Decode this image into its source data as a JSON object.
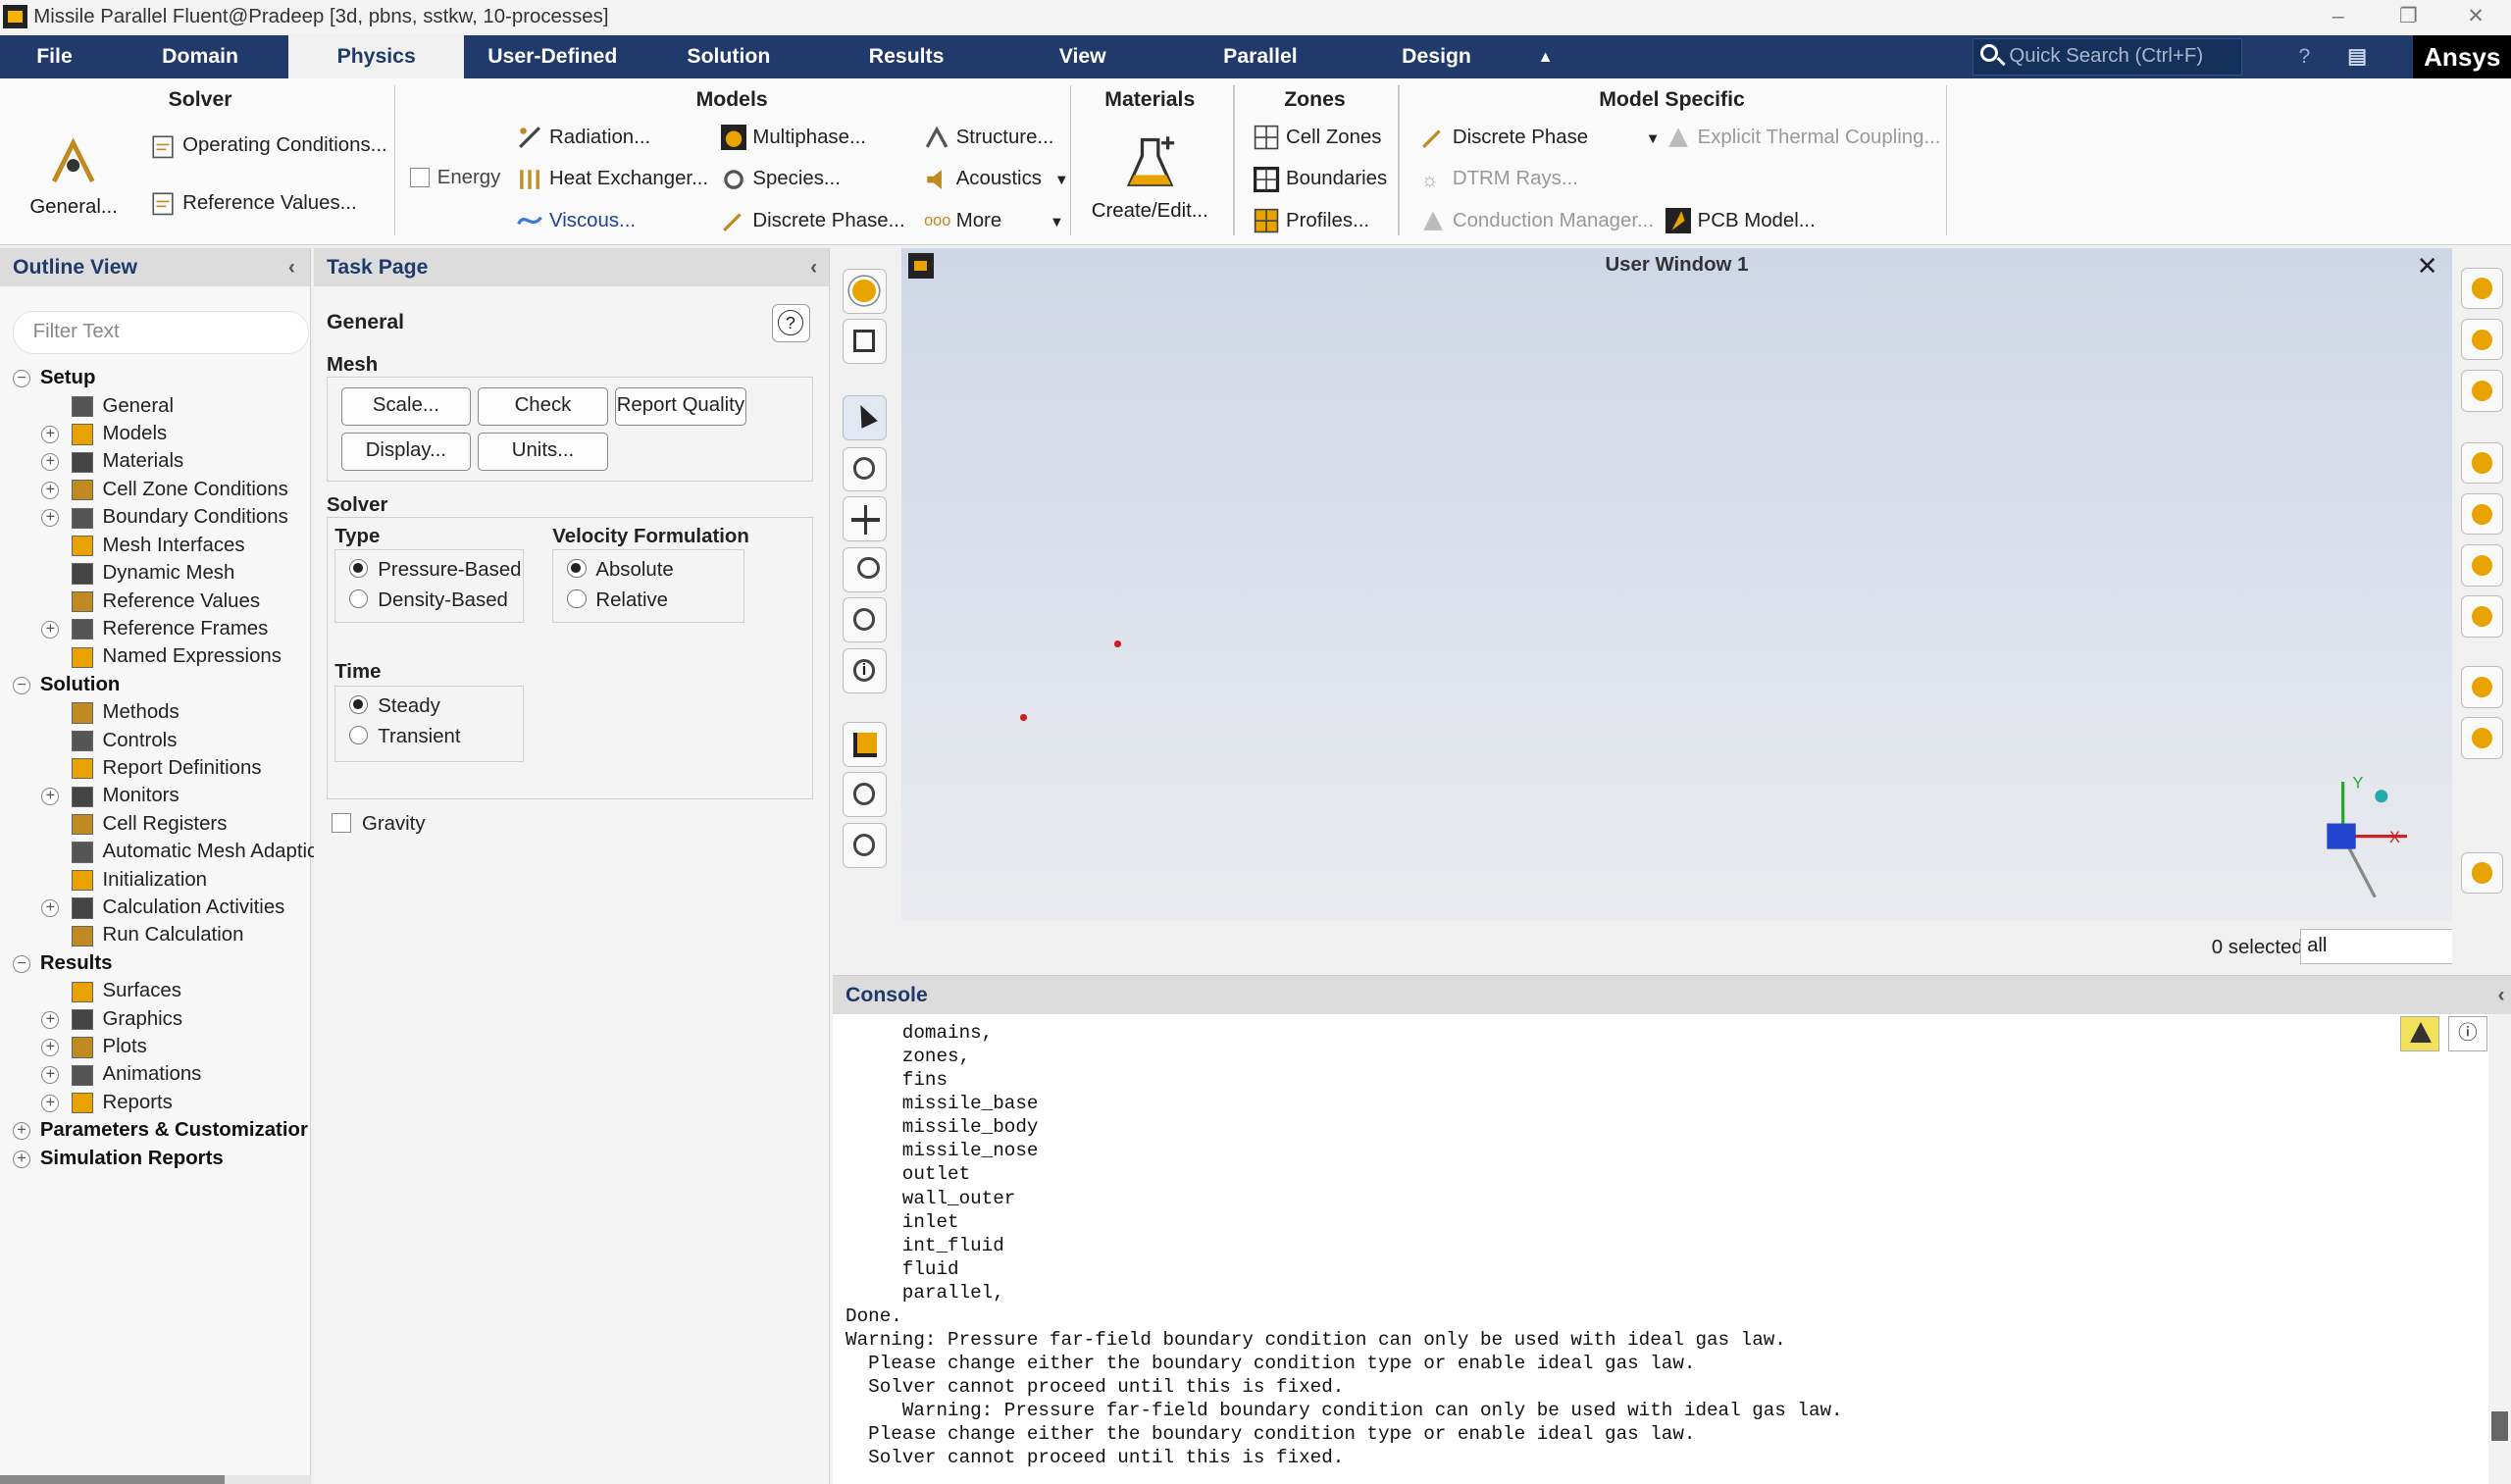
{
  "window": {
    "title": "Missile Parallel Fluent@Pradeep  [3d, pbns, sstkw, 10-processes]"
  },
  "menu": {
    "tabs": [
      "File",
      "Domain",
      "Physics",
      "User-Defined",
      "Solution",
      "Results",
      "View",
      "Parallel",
      "Design"
    ],
    "active": "Physics",
    "search_placeholder": "Quick Search (Ctrl+F)",
    "brand": "Ansys"
  },
  "ribbon": {
    "solver": {
      "title": "Solver",
      "general": "General...",
      "operating": "Operating Conditions...",
      "reference": "Reference Values..."
    },
    "models": {
      "title": "Models",
      "energy": "Energy",
      "radiation": "Radiation...",
      "heat_exchanger": "Heat Exchanger...",
      "viscous": "Viscous...",
      "multiphase": "Multiphase...",
      "species": "Species...",
      "discrete_phase": "Discrete Phase...",
      "structure": "Structure...",
      "acoustics": "Acoustics",
      "more": "More"
    },
    "materials": {
      "title": "Materials",
      "create_edit": "Create/Edit..."
    },
    "zones": {
      "title": "Zones",
      "cell_zones": "Cell Zones",
      "boundaries": "Boundaries",
      "profiles": "Profiles..."
    },
    "model_specific": {
      "title": "Model Specific",
      "discrete_phase": "Discrete Phase",
      "dtrm": "DTRM Rays...",
      "conduction": "Conduction Manager...",
      "explicit_thermal": "Explicit Thermal Coupling...",
      "pcb": "PCB Model..."
    }
  },
  "outline": {
    "title": "Outline View",
    "filter_placeholder": "Filter Text",
    "items": [
      {
        "label": "Setup",
        "level": 0,
        "bold": true,
        "pm": "−"
      },
      {
        "label": "General",
        "level": 1
      },
      {
        "label": "Models",
        "level": 1,
        "pm": "+"
      },
      {
        "label": "Materials",
        "level": 1,
        "pm": "+"
      },
      {
        "label": "Cell Zone Conditions",
        "level": 1,
        "pm": "+"
      },
      {
        "label": "Boundary Conditions",
        "level": 1,
        "pm": "+"
      },
      {
        "label": "Mesh Interfaces",
        "level": 1
      },
      {
        "label": "Dynamic Mesh",
        "level": 1
      },
      {
        "label": "Reference Values",
        "level": 1
      },
      {
        "label": "Reference Frames",
        "level": 1,
        "pm": "+"
      },
      {
        "label": "Named Expressions",
        "level": 1
      },
      {
        "label": "Solution",
        "level": 0,
        "bold": true,
        "pm": "−"
      },
      {
        "label": "Methods",
        "level": 1
      },
      {
        "label": "Controls",
        "level": 1
      },
      {
        "label": "Report Definitions",
        "level": 1
      },
      {
        "label": "Monitors",
        "level": 1,
        "pm": "+"
      },
      {
        "label": "Cell Registers",
        "level": 1
      },
      {
        "label": "Automatic Mesh Adaptic",
        "level": 1
      },
      {
        "label": "Initialization",
        "level": 1
      },
      {
        "label": "Calculation Activities",
        "level": 1,
        "pm": "+"
      },
      {
        "label": "Run Calculation",
        "level": 1
      },
      {
        "label": "Results",
        "level": 0,
        "bold": true,
        "pm": "−"
      },
      {
        "label": "Surfaces",
        "level": 1
      },
      {
        "label": "Graphics",
        "level": 1,
        "pm": "+"
      },
      {
        "label": "Plots",
        "level": 1,
        "pm": "+"
      },
      {
        "label": "Animations",
        "level": 1,
        "pm": "+"
      },
      {
        "label": "Reports",
        "level": 1,
        "pm": "+"
      },
      {
        "label": "Parameters & Customizatior",
        "level": 0,
        "bold": true,
        "pm": "+"
      },
      {
        "label": "Simulation Reports",
        "level": 0,
        "bold": true,
        "pm": "+"
      }
    ]
  },
  "task": {
    "title": "Task Page",
    "heading": "General",
    "mesh_label": "Mesh",
    "scale": "Scale...",
    "check": "Check",
    "report_quality": "Report Quality",
    "display": "Display...",
    "units": "Units...",
    "solver_label": "Solver",
    "type_label": "Type",
    "pressure_based": "Pressure-Based",
    "density_based": "Density-Based",
    "velocity_label": "Velocity Formulation",
    "absolute": "Absolute",
    "relative": "Relative",
    "time_label": "Time",
    "steady": "Steady",
    "transient": "Transient",
    "gravity": "Gravity"
  },
  "graphics": {
    "title": "User Window 1",
    "selected": "0 selected",
    "filter_value": "all"
  },
  "console": {
    "title": "Console",
    "lines": [
      "     domains,",
      "     zones,",
      "     fins",
      "     missile_base",
      "     missile_body",
      "     missile_nose",
      "     outlet",
      "     wall_outer",
      "     inlet",
      "     int_fluid",
      "     fluid",
      "     parallel,",
      "Done.",
      "Warning: Pressure far-field boundary condition can only be used with ideal gas law.",
      "  Please change either the boundary condition type or enable ideal gas law.",
      "  Solver cannot proceed until this is fixed.",
      "     Warning: Pressure far-field boundary condition can only be used with ideal gas law.",
      "  Please change either the boundary condition type or enable ideal gas law.",
      "  Solver cannot proceed until this is fixed."
    ]
  },
  "colors": {
    "menubar": "#1f3a6b",
    "accent": "#e8a300",
    "point": "#cc1f1f"
  }
}
